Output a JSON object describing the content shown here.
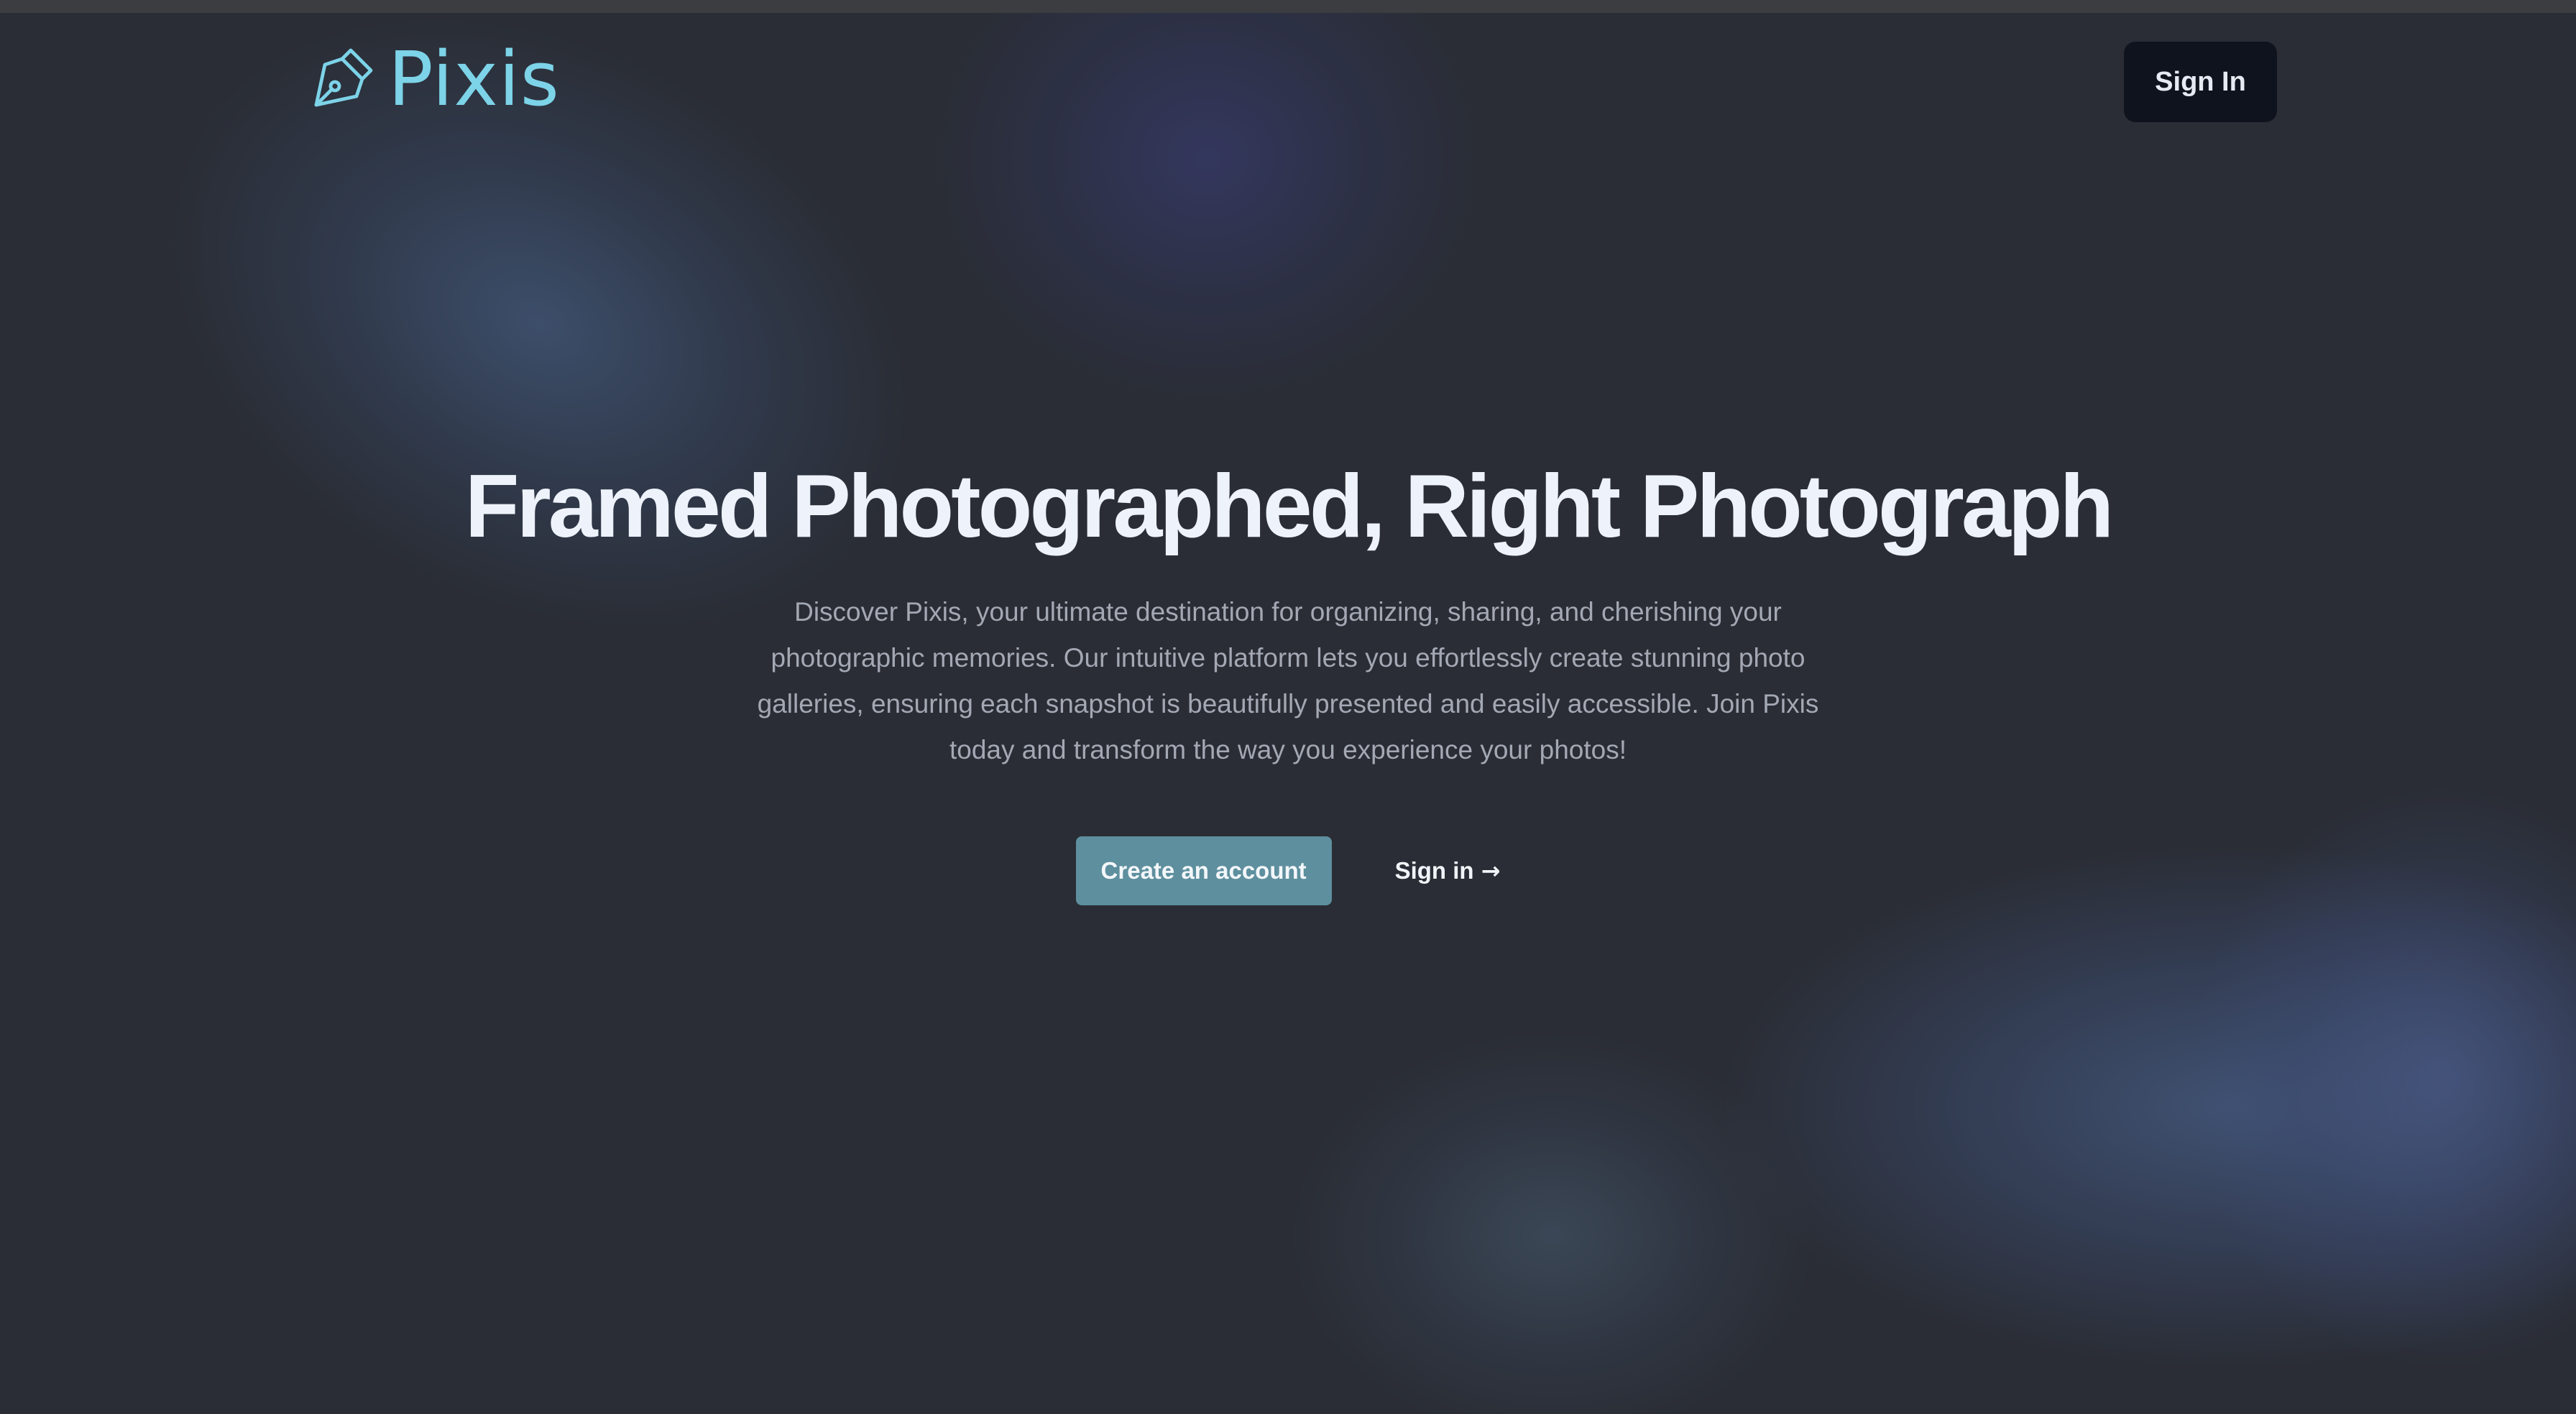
{
  "brand": {
    "name": "Pixis",
    "icon": "pen-nib-icon",
    "color": "#7dd3e8"
  },
  "header": {
    "signin_label": "Sign In"
  },
  "hero": {
    "title": "Framed Photographed, Right Photograph",
    "description": "Discover Pixis, your ultimate destination for organizing, sharing, and cherishing your photographic memories. Our intuitive platform lets you effortlessly create stunning photo galleries, ensuring each snapshot is beautifully presented and easily accessible. Join Pixis today and transform the way you experience your photos!",
    "primary_cta": "Create an account",
    "secondary_cta": "Sign in",
    "secondary_icon": "arrow-right-icon"
  },
  "colors": {
    "background": "#2a2d35",
    "primary_button": "#5e8f9e",
    "header_button": "#0f131e",
    "title": "#eef2fa",
    "body_text": "#a3a8b4"
  }
}
